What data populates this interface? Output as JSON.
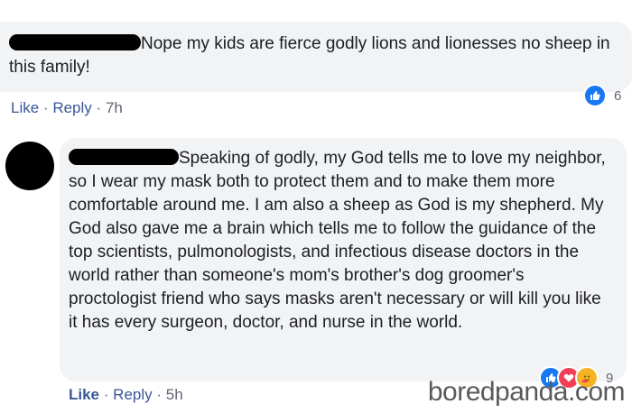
{
  "comment1": {
    "text": "Nope my kids are fierce godly lions and lionesses no sheep in this family!",
    "actions": {
      "like": "Like",
      "reply": "Reply",
      "sep": "·",
      "time": "7h"
    },
    "reactions": {
      "count": "6",
      "icons": [
        "like"
      ]
    }
  },
  "comment2": {
    "text": "Speaking of godly, my God tells me to love my neighbor, so I wear my mask both to protect them and to make them more comfortable around me. I am also a sheep as God is my shepherd. My God also gave me a brain which tells me to follow the guidance of the top scientists, pulmonologists, and infectious disease doctors in the world rather than someone's mom's brother's dog groomer's proctologist friend who says masks aren't necessary or will kill you like it has every surgeon, doctor, and nurse in the world.",
    "actions": {
      "like": "Like",
      "reply": "Reply",
      "sep": "·",
      "time": "5h"
    },
    "reactions": {
      "count": "9",
      "icons": [
        "like",
        "love",
        "care"
      ]
    }
  },
  "watermark": "boredpanda.com",
  "colors": {
    "bubble": "#f2f3f5",
    "link": "#385898",
    "meta": "#606770",
    "like": "#1877f2",
    "love": "#f33e58",
    "care": "#f7b125"
  }
}
